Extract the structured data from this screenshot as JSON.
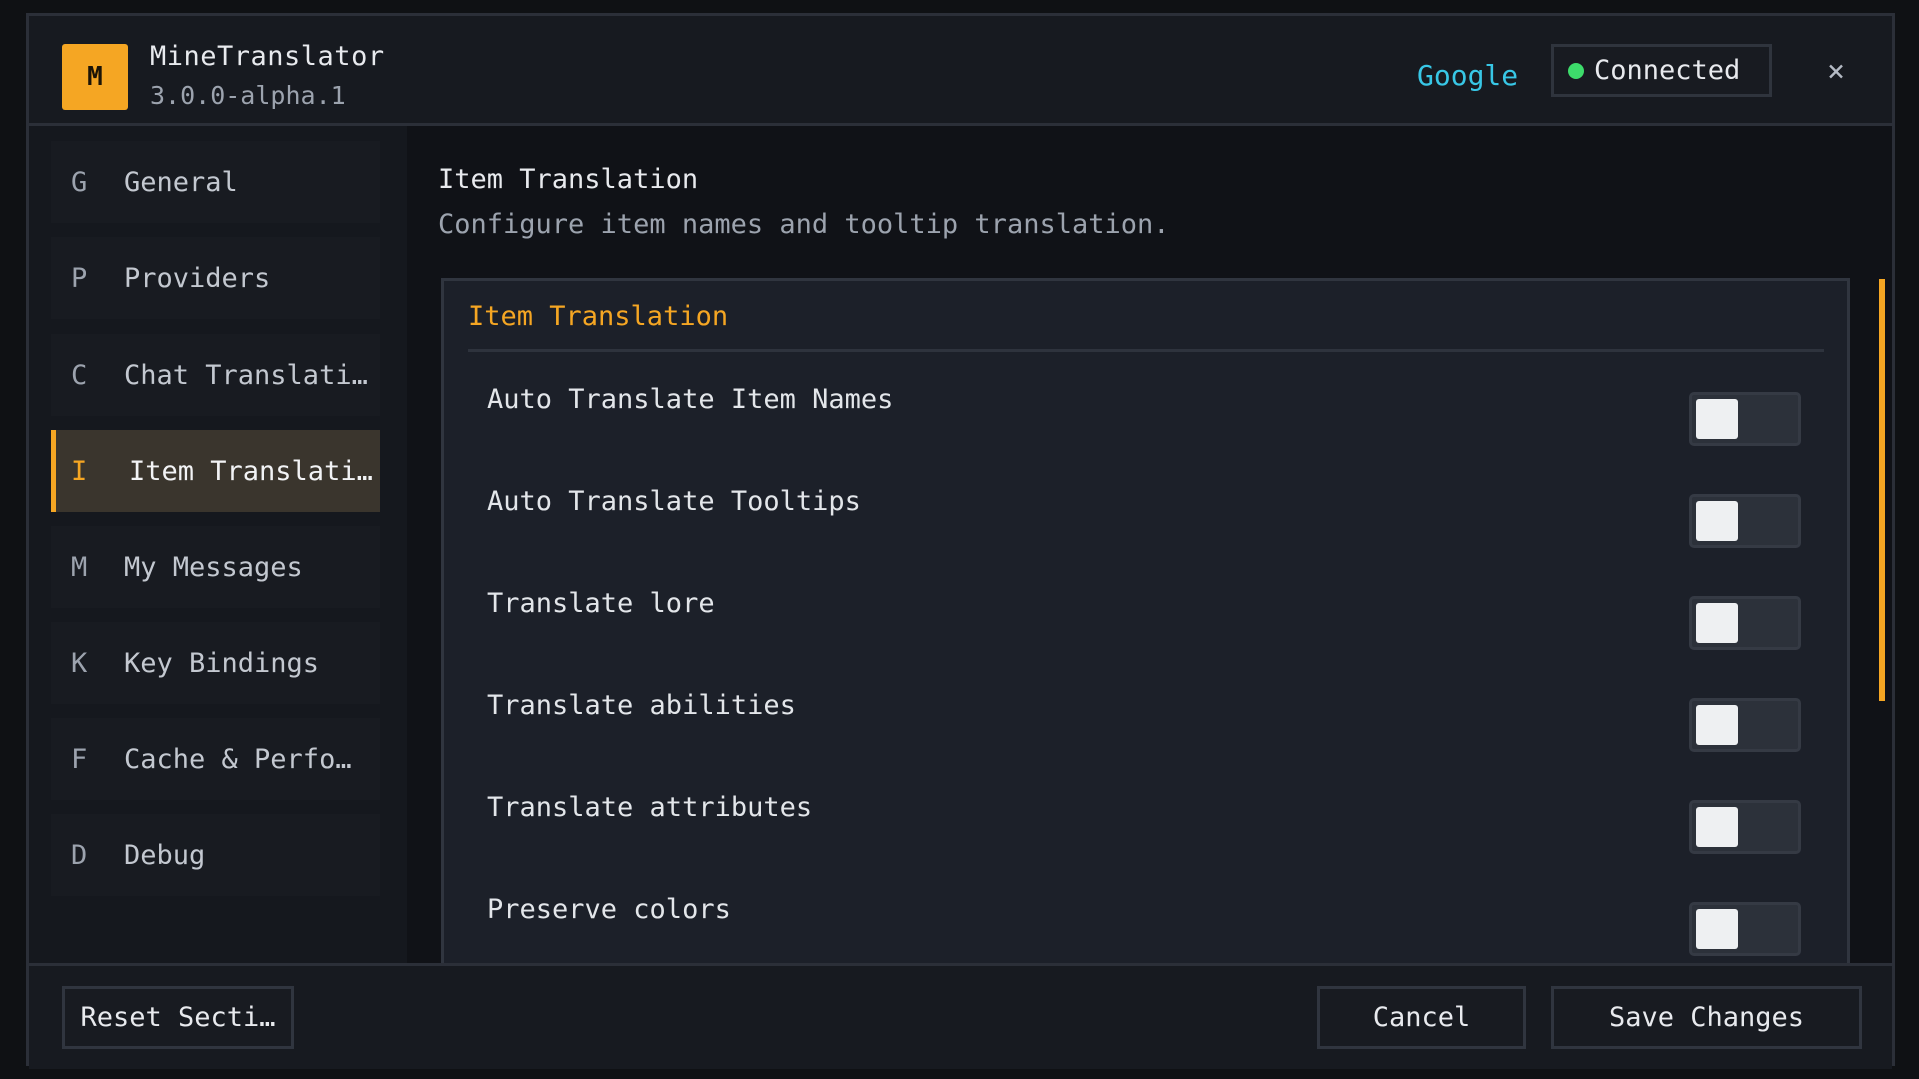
{
  "header": {
    "logo_glyph": "M",
    "app_name": "MineTranslator",
    "version": "3.0.0-alpha.1",
    "provider": "Google",
    "status": "Connected",
    "status_color": "#3ddc6b",
    "close_glyph": "×"
  },
  "sidebar": {
    "items": [
      {
        "key": "G",
        "label": "General",
        "active": false
      },
      {
        "key": "P",
        "label": "Providers",
        "active": false
      },
      {
        "key": "C",
        "label": "Chat Translati…",
        "active": false
      },
      {
        "key": "I",
        "label": "Item Translati…",
        "active": true
      },
      {
        "key": "M",
        "label": "My Messages",
        "active": false
      },
      {
        "key": "K",
        "label": "Key Bindings",
        "active": false
      },
      {
        "key": "F",
        "label": "Cache & Perfo…",
        "active": false
      },
      {
        "key": "D",
        "label": "Debug",
        "active": false
      }
    ]
  },
  "main": {
    "title": "Item Translation",
    "description": "Configure item names and tooltip translation.",
    "card": {
      "title": "Item Translation",
      "options": [
        {
          "label": "Auto Translate Item Names",
          "enabled": false
        },
        {
          "label": "Auto Translate Tooltips",
          "enabled": false
        },
        {
          "label": "Translate lore",
          "enabled": false
        },
        {
          "label": "Translate abilities",
          "enabled": false
        },
        {
          "label": "Translate attributes",
          "enabled": false
        },
        {
          "label": "Preserve colors",
          "enabled": false
        }
      ]
    }
  },
  "footer": {
    "reset_label": "Reset Secti…",
    "cancel_label": "Cancel",
    "save_label": "Save Changes"
  },
  "colors": {
    "accent": "#f5a623",
    "link": "#38c7e6"
  }
}
